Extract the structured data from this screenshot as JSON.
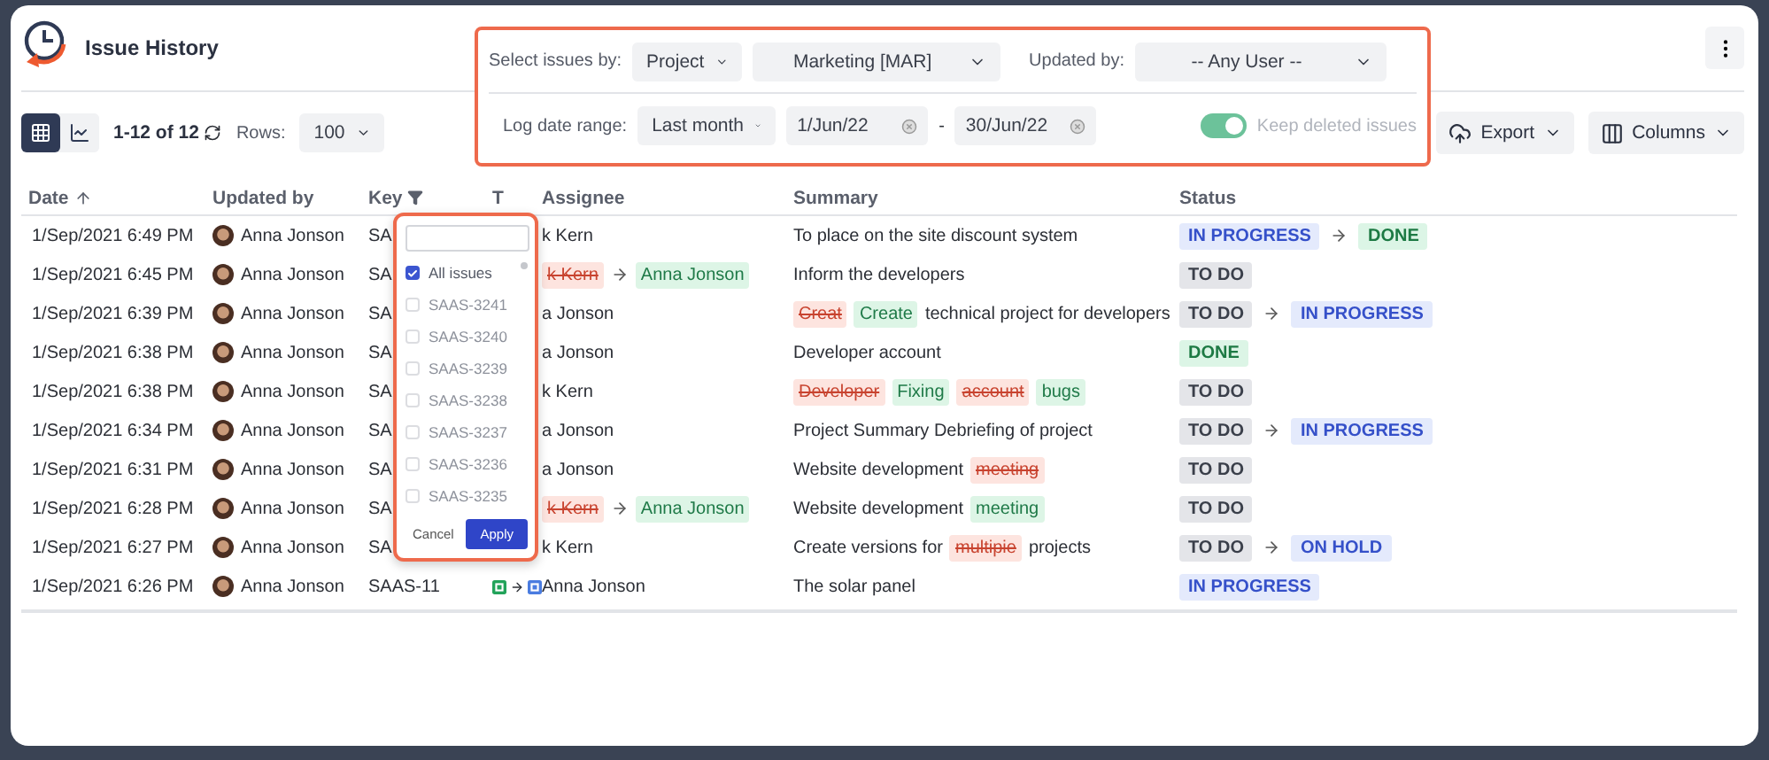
{
  "header": {
    "title": "Issue History"
  },
  "filters": {
    "select_by_label": "Select issues by:",
    "select_by": "Project",
    "project": "Marketing [MAR]",
    "updated_by_label": "Updated by:",
    "updated_by": "-- Any User --",
    "date_range_label": "Log date range:",
    "date_range": "Last month",
    "date_from": "1/Jun/22",
    "date_separator": "-",
    "date_to": "30/Jun/22",
    "keep_deleted": {
      "label": "Keep deleted issues",
      "on": true
    }
  },
  "toolbar": {
    "views": [
      {
        "kind": "grid",
        "selected": true
      },
      {
        "kind": "chart",
        "selected": false
      }
    ],
    "range": "1-12 of 12",
    "rows_label": "Rows:",
    "rows": "100",
    "export": "Export",
    "columns": "Columns"
  },
  "table": {
    "columns": [
      {
        "label": "Date",
        "kind": "sorted"
      },
      {
        "label": "Updated by",
        "kind": "plain"
      },
      {
        "label": "Key",
        "kind": "filtered"
      },
      {
        "label": "T",
        "kind": "plain"
      },
      {
        "label": "Assignee",
        "kind": "plain"
      },
      {
        "label": "Summary",
        "kind": "plain"
      },
      {
        "label": "Status",
        "kind": "plain"
      }
    ],
    "rows": [
      {
        "date": "1/Sep/2021 6:49 PM",
        "updated_by": "Anna Jonson",
        "key": "SA",
        "type_change": false,
        "assignee": {
          "kind": "plain",
          "text": "k Kern"
        },
        "summary": [
          {
            "kind": "plain",
            "text": "To place on the site discount system"
          }
        ],
        "status": [
          {
            "kind": "progress",
            "text": "IN PROGRESS"
          },
          {
            "kind": "done",
            "text": "DONE"
          }
        ]
      },
      {
        "date": "1/Sep/2021 6:45 PM",
        "updated_by": "Anna Jonson",
        "key": "SA",
        "type_change": false,
        "assignee": {
          "kind": "change",
          "from": "k Kern",
          "to": "Anna Jonson"
        },
        "summary": [
          {
            "kind": "plain",
            "text": "Inform the developers"
          }
        ],
        "status": [
          {
            "kind": "todo",
            "text": "TO DO"
          }
        ]
      },
      {
        "date": "1/Sep/2021 6:39 PM",
        "updated_by": "Anna Jonson",
        "key": "SA",
        "type_change": false,
        "assignee": {
          "kind": "plain",
          "text": "a Jonson"
        },
        "summary": [
          {
            "kind": "removed",
            "text": "Creat"
          },
          {
            "kind": "added",
            "text": "Create"
          },
          {
            "kind": "plain",
            "text": "technical project for developers"
          }
        ],
        "status": [
          {
            "kind": "todo",
            "text": "TO DO"
          },
          {
            "kind": "progress",
            "text": "IN PROGRESS"
          }
        ]
      },
      {
        "date": "1/Sep/2021 6:38 PM",
        "updated_by": "Anna Jonson",
        "key": "SA",
        "type_change": false,
        "assignee": {
          "kind": "plain",
          "text": "a Jonson"
        },
        "summary": [
          {
            "kind": "plain",
            "text": "Developer account"
          }
        ],
        "status": [
          {
            "kind": "done",
            "text": "DONE"
          }
        ]
      },
      {
        "date": "1/Sep/2021 6:38 PM",
        "updated_by": "Anna Jonson",
        "key": "SA",
        "type_change": false,
        "assignee": {
          "kind": "plain",
          "text": "k Kern"
        },
        "summary": [
          {
            "kind": "removed",
            "text": "Developer"
          },
          {
            "kind": "added",
            "text": "Fixing"
          },
          {
            "kind": "removed",
            "text": "account"
          },
          {
            "kind": "added",
            "text": "bugs"
          }
        ],
        "status": [
          {
            "kind": "todo",
            "text": "TO DO"
          }
        ]
      },
      {
        "date": "1/Sep/2021 6:34 PM",
        "updated_by": "Anna Jonson",
        "key": "SA",
        "type_change": false,
        "assignee": {
          "kind": "plain",
          "text": "a Jonson"
        },
        "summary": [
          {
            "kind": "plain",
            "text": "Project Summary Debriefing of project"
          }
        ],
        "status": [
          {
            "kind": "todo",
            "text": "TO DO"
          },
          {
            "kind": "progress",
            "text": "IN PROGRESS"
          }
        ]
      },
      {
        "date": "1/Sep/2021 6:31 PM",
        "updated_by": "Anna Jonson",
        "key": "SA",
        "type_change": false,
        "assignee": {
          "kind": "plain",
          "text": "a Jonson"
        },
        "summary": [
          {
            "kind": "plain",
            "text": "Website development"
          },
          {
            "kind": "removed",
            "text": "meeting"
          }
        ],
        "status": [
          {
            "kind": "todo",
            "text": "TO DO"
          }
        ]
      },
      {
        "date": "1/Sep/2021 6:28 PM",
        "updated_by": "Anna Jonson",
        "key": "SA",
        "type_change": false,
        "assignee": {
          "kind": "change",
          "from": "k Kern",
          "to": "Anna Jonson"
        },
        "summary": [
          {
            "kind": "plain",
            "text": "Website development"
          },
          {
            "kind": "added",
            "text": "meeting"
          }
        ],
        "status": [
          {
            "kind": "todo",
            "text": "TO DO"
          }
        ]
      },
      {
        "date": "1/Sep/2021 6:27 PM",
        "updated_by": "Anna Jonson",
        "key": "SA",
        "type_change": false,
        "assignee": {
          "kind": "plain",
          "text": "k Kern"
        },
        "summary": [
          {
            "kind": "plain",
            "text": "Create versions for"
          },
          {
            "kind": "removed",
            "text": "multipie"
          },
          {
            "kind": "plain",
            "text": "projects"
          }
        ],
        "status": [
          {
            "kind": "todo",
            "text": "TO DO"
          },
          {
            "kind": "hold",
            "text": "ON HOLD"
          }
        ]
      },
      {
        "date": "1/Sep/2021 6:26 PM",
        "updated_by": "Anna Jonson",
        "key": "SAAS-11",
        "type_change": true,
        "assignee": {
          "kind": "plain",
          "text": "Anna Jonson"
        },
        "summary": [
          {
            "kind": "plain",
            "text": "The solar panel"
          }
        ],
        "status": [
          {
            "kind": "progress",
            "text": "IN PROGRESS"
          }
        ]
      }
    ]
  },
  "key_filter": {
    "options": [
      {
        "label": "All issues",
        "checked": true
      },
      {
        "label": "SAAS-3241",
        "checked": false
      },
      {
        "label": "SAAS-3240",
        "checked": false
      },
      {
        "label": "SAAS-3239",
        "checked": false
      },
      {
        "label": "SAAS-3238",
        "checked": false
      },
      {
        "label": "SAAS-3237",
        "checked": false
      },
      {
        "label": "SAAS-3236",
        "checked": false
      },
      {
        "label": "SAAS-3235",
        "checked": false
      }
    ],
    "cancel": "Cancel",
    "apply": "Apply"
  }
}
